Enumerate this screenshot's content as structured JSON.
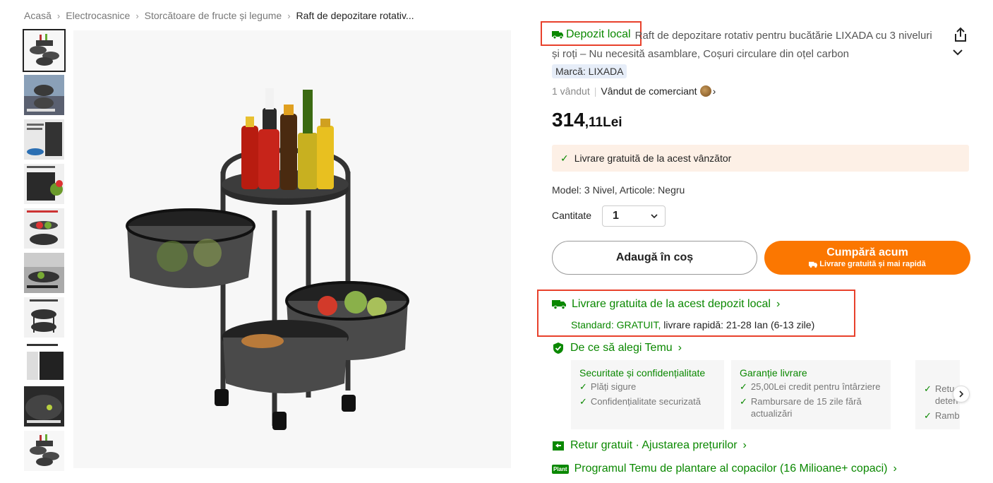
{
  "breadcrumb": [
    "Acasă",
    "Electrocasnice",
    "Storcătoare de fructe și legume",
    "Raft de depozitare rotativ..."
  ],
  "product": {
    "local_tag": "Depozit local",
    "title": "Raft de depozitare rotativ pentru bucătărie LIXADA cu 3 niveluri și roți – Nu necesită asamblare, Coșuri circulare din oțel carbon",
    "brand": "Marcă: LIXADA",
    "sold": "1 vândut",
    "seller": "Vândut de comerciant",
    "price_int": "314",
    "price_dec": ",11",
    "price_currency": "Lei",
    "free_shipping_banner": "Livrare gratuită de la acest vânzător",
    "model": "Model: 3 Nivel, Articole: Negru",
    "qty_label": "Cantitate",
    "qty_value": "1"
  },
  "buttons": {
    "add_to_cart": "Adaugă în coș",
    "buy_now": "Cumpără acum",
    "buy_now_sub": "Livrare gratuită și mai rapidă"
  },
  "shipping": {
    "local_title": "Livrare gratuita de la acest depozit local",
    "standard": "Standard: GRATUIT,",
    "fast": " livrare rapidă: 21-28 Ian (6-13 zile)"
  },
  "why": {
    "title": "De ce să alegi Temu",
    "cards": [
      {
        "title": "Securitate și confidențialitate",
        "lines": [
          "Plăți sigure",
          "Confidențialitate securizată"
        ]
      },
      {
        "title": "Garanție livrare",
        "lines": [
          "25,00Lei credit pentru întârziere",
          "Rambursare de 15 zile fără actualizări"
        ]
      },
      {
        "title": "",
        "lines": [
          "Retu deteri",
          "Ramb"
        ]
      }
    ]
  },
  "extras": {
    "retur": "Retur gratuit · Ajustarea prețurilor",
    "plant": "Programul Temu de plantare al copacilor (16 Milioane+ copaci)",
    "plant_icon": "Plant"
  },
  "colors": {
    "accent_orange": "#fb7701",
    "green": "#0a8800",
    "highlight_red": "#e8412c"
  }
}
